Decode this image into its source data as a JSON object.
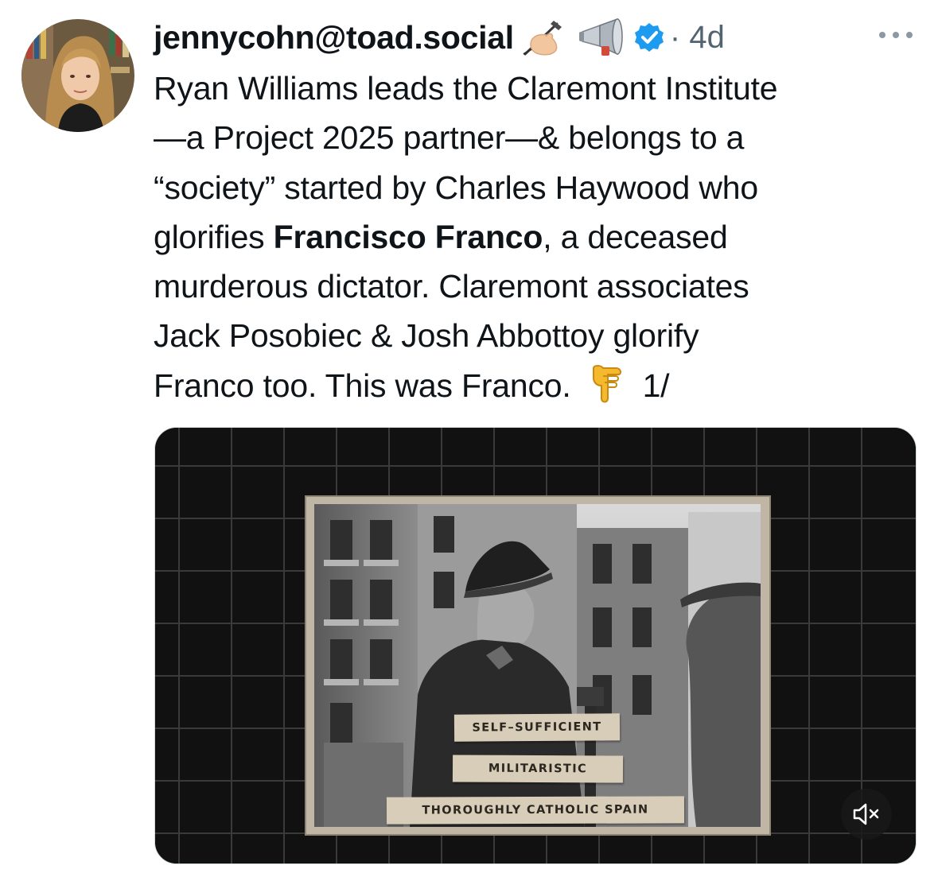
{
  "post": {
    "author": {
      "handle": "jennycohn@toad.social",
      "badge_icons": [
        "writing-hand-icon",
        "megaphone-icon",
        "verified-badge-icon"
      ]
    },
    "separator": "·",
    "time": "4d",
    "more_icon": "more-options-icon",
    "text": {
      "line1": "Ryan Williams leads the Claremont Institute",
      "line2": "—a Project 2025 partner—& belongs to a",
      "line3": "“society” started by Charles Haywood who",
      "line4_before": "glorifies ",
      "line4_bold": "Francisco Franco",
      "line4_after": ", a deceased",
      "line5": "murderous dictator. Claremont associates",
      "line6": "Jack Posobiec & Josh Abbottoy glorify",
      "line7_text": "Franco too. This was Franco.",
      "line7_emoji": "backhand-index-pointing-down-icon",
      "line7_suffix": "1/"
    },
    "media": {
      "labels": [
        "SELF–SUFFICIENT",
        "MILITARISTIC",
        "THOROUGHLY CATHOLIC SPAIN"
      ],
      "mute_icon": "volume-muted-icon"
    }
  }
}
